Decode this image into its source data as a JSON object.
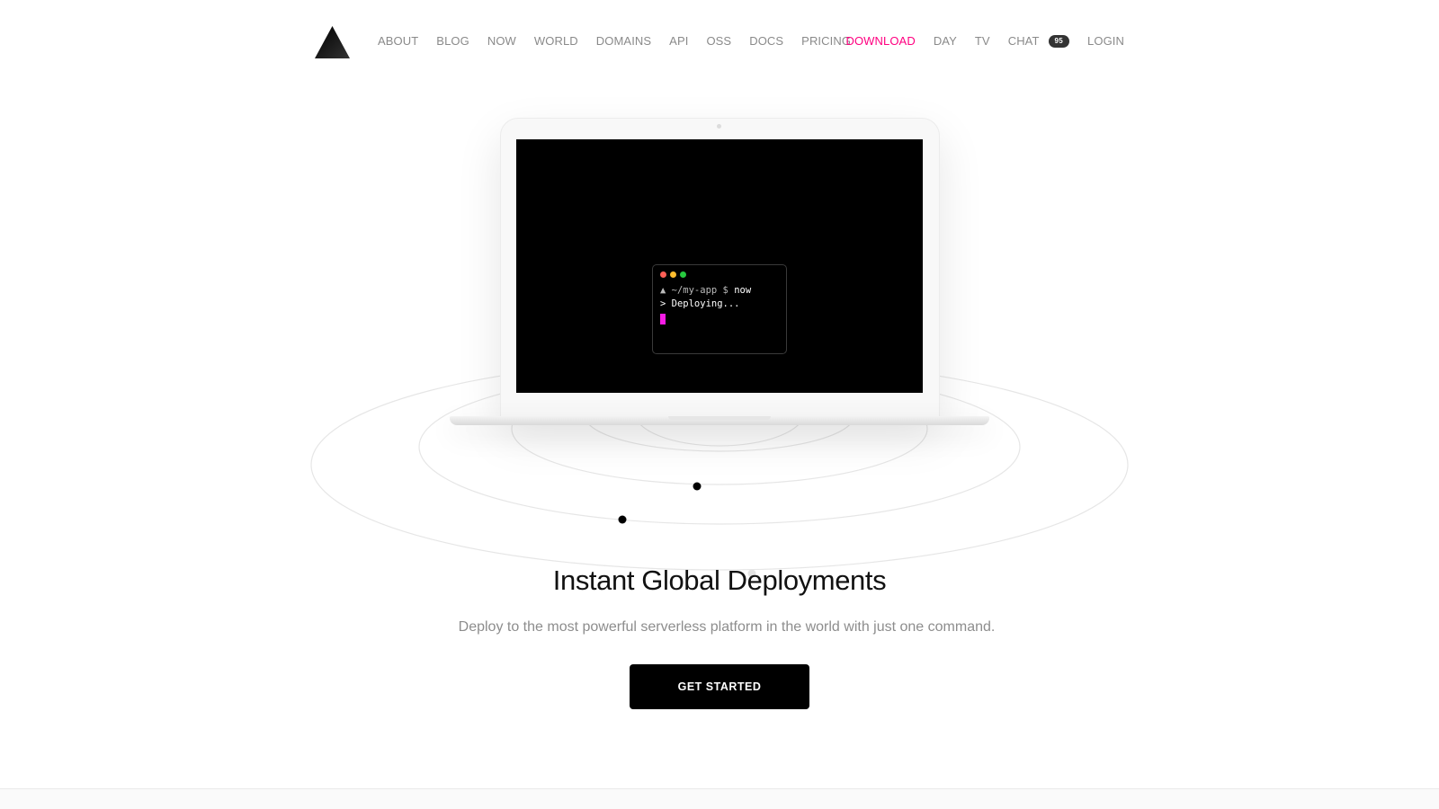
{
  "nav": {
    "left_links": [
      "ABOUT",
      "BLOG",
      "NOW",
      "WORLD",
      "DOMAINS",
      "API",
      "OSS",
      "DOCS",
      "PRICING"
    ],
    "download": "DOWNLOAD",
    "day": "DAY",
    "tv": "TV",
    "chat": "CHAT",
    "chat_badge": "95",
    "login": "LOGIN",
    "accent_color": "#ff0080"
  },
  "terminal": {
    "line1_prefix": "▲ ~/my-app $",
    "line1_cmd": "now",
    "line2": "> Deploying...",
    "cursor_color": "#f81ce5"
  },
  "hero": {
    "title": "Instant Global Deployments",
    "subtitle": "Deploy to the most powerful serverless platform in the world with just one command.",
    "cta": "GET STARTED"
  }
}
